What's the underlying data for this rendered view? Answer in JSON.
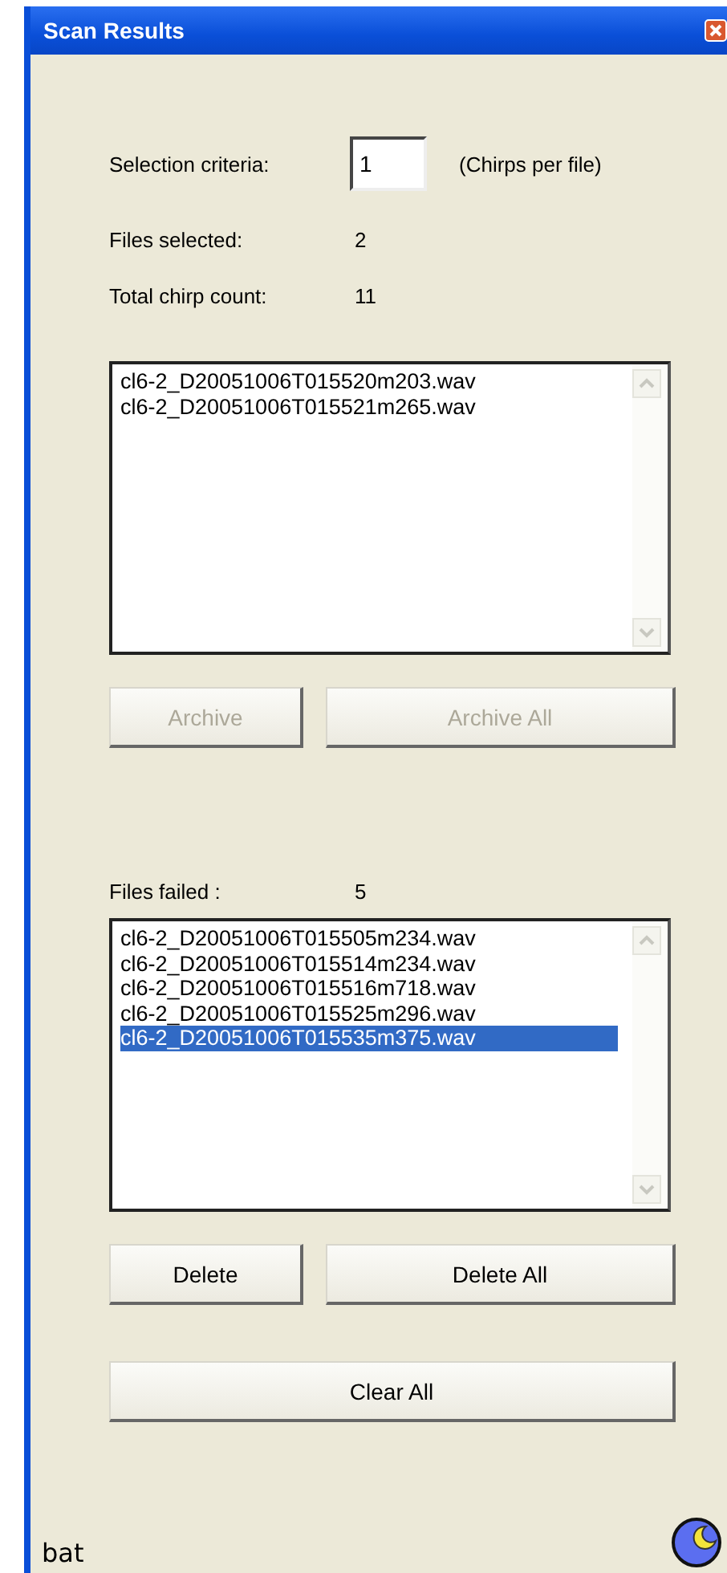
{
  "window": {
    "title": "Scan Results"
  },
  "selection_criteria": {
    "label": "Selection criteria:",
    "value": "1",
    "unit": "(Chirps per file)"
  },
  "stats": [
    {
      "label": "Files selected:",
      "value": "2"
    },
    {
      "label": "Total chirp count:",
      "value": "11"
    }
  ],
  "selected_files": [
    {
      "name": "cl6-2_D20051006T015520m203.wav",
      "selected": false
    },
    {
      "name": "cl6-2_D20051006T015521m265.wav",
      "selected": false
    }
  ],
  "selected_buttons": [
    {
      "label": "Archive",
      "disabled": true
    },
    {
      "label": "Archive All",
      "disabled": true
    }
  ],
  "failed": {
    "label": "Files failed :",
    "value": "5"
  },
  "failed_files": [
    {
      "name": "cl6-2_D20051006T015505m234.wav",
      "selected": false
    },
    {
      "name": "cl6-2_D20051006T015514m234.wav",
      "selected": false
    },
    {
      "name": "cl6-2_D20051006T015516m718.wav",
      "selected": false
    },
    {
      "name": "cl6-2_D20051006T015525m296.wav",
      "selected": false
    },
    {
      "name": "cl6-2_D20051006T015535m375.wav",
      "selected": true
    }
  ],
  "failed_buttons": [
    {
      "label": "Delete",
      "disabled": false
    },
    {
      "label": "Delete All",
      "disabled": false
    }
  ],
  "clear_button": {
    "label": "Clear All",
    "disabled": false
  },
  "footer": {
    "logo_text": "bat"
  }
}
